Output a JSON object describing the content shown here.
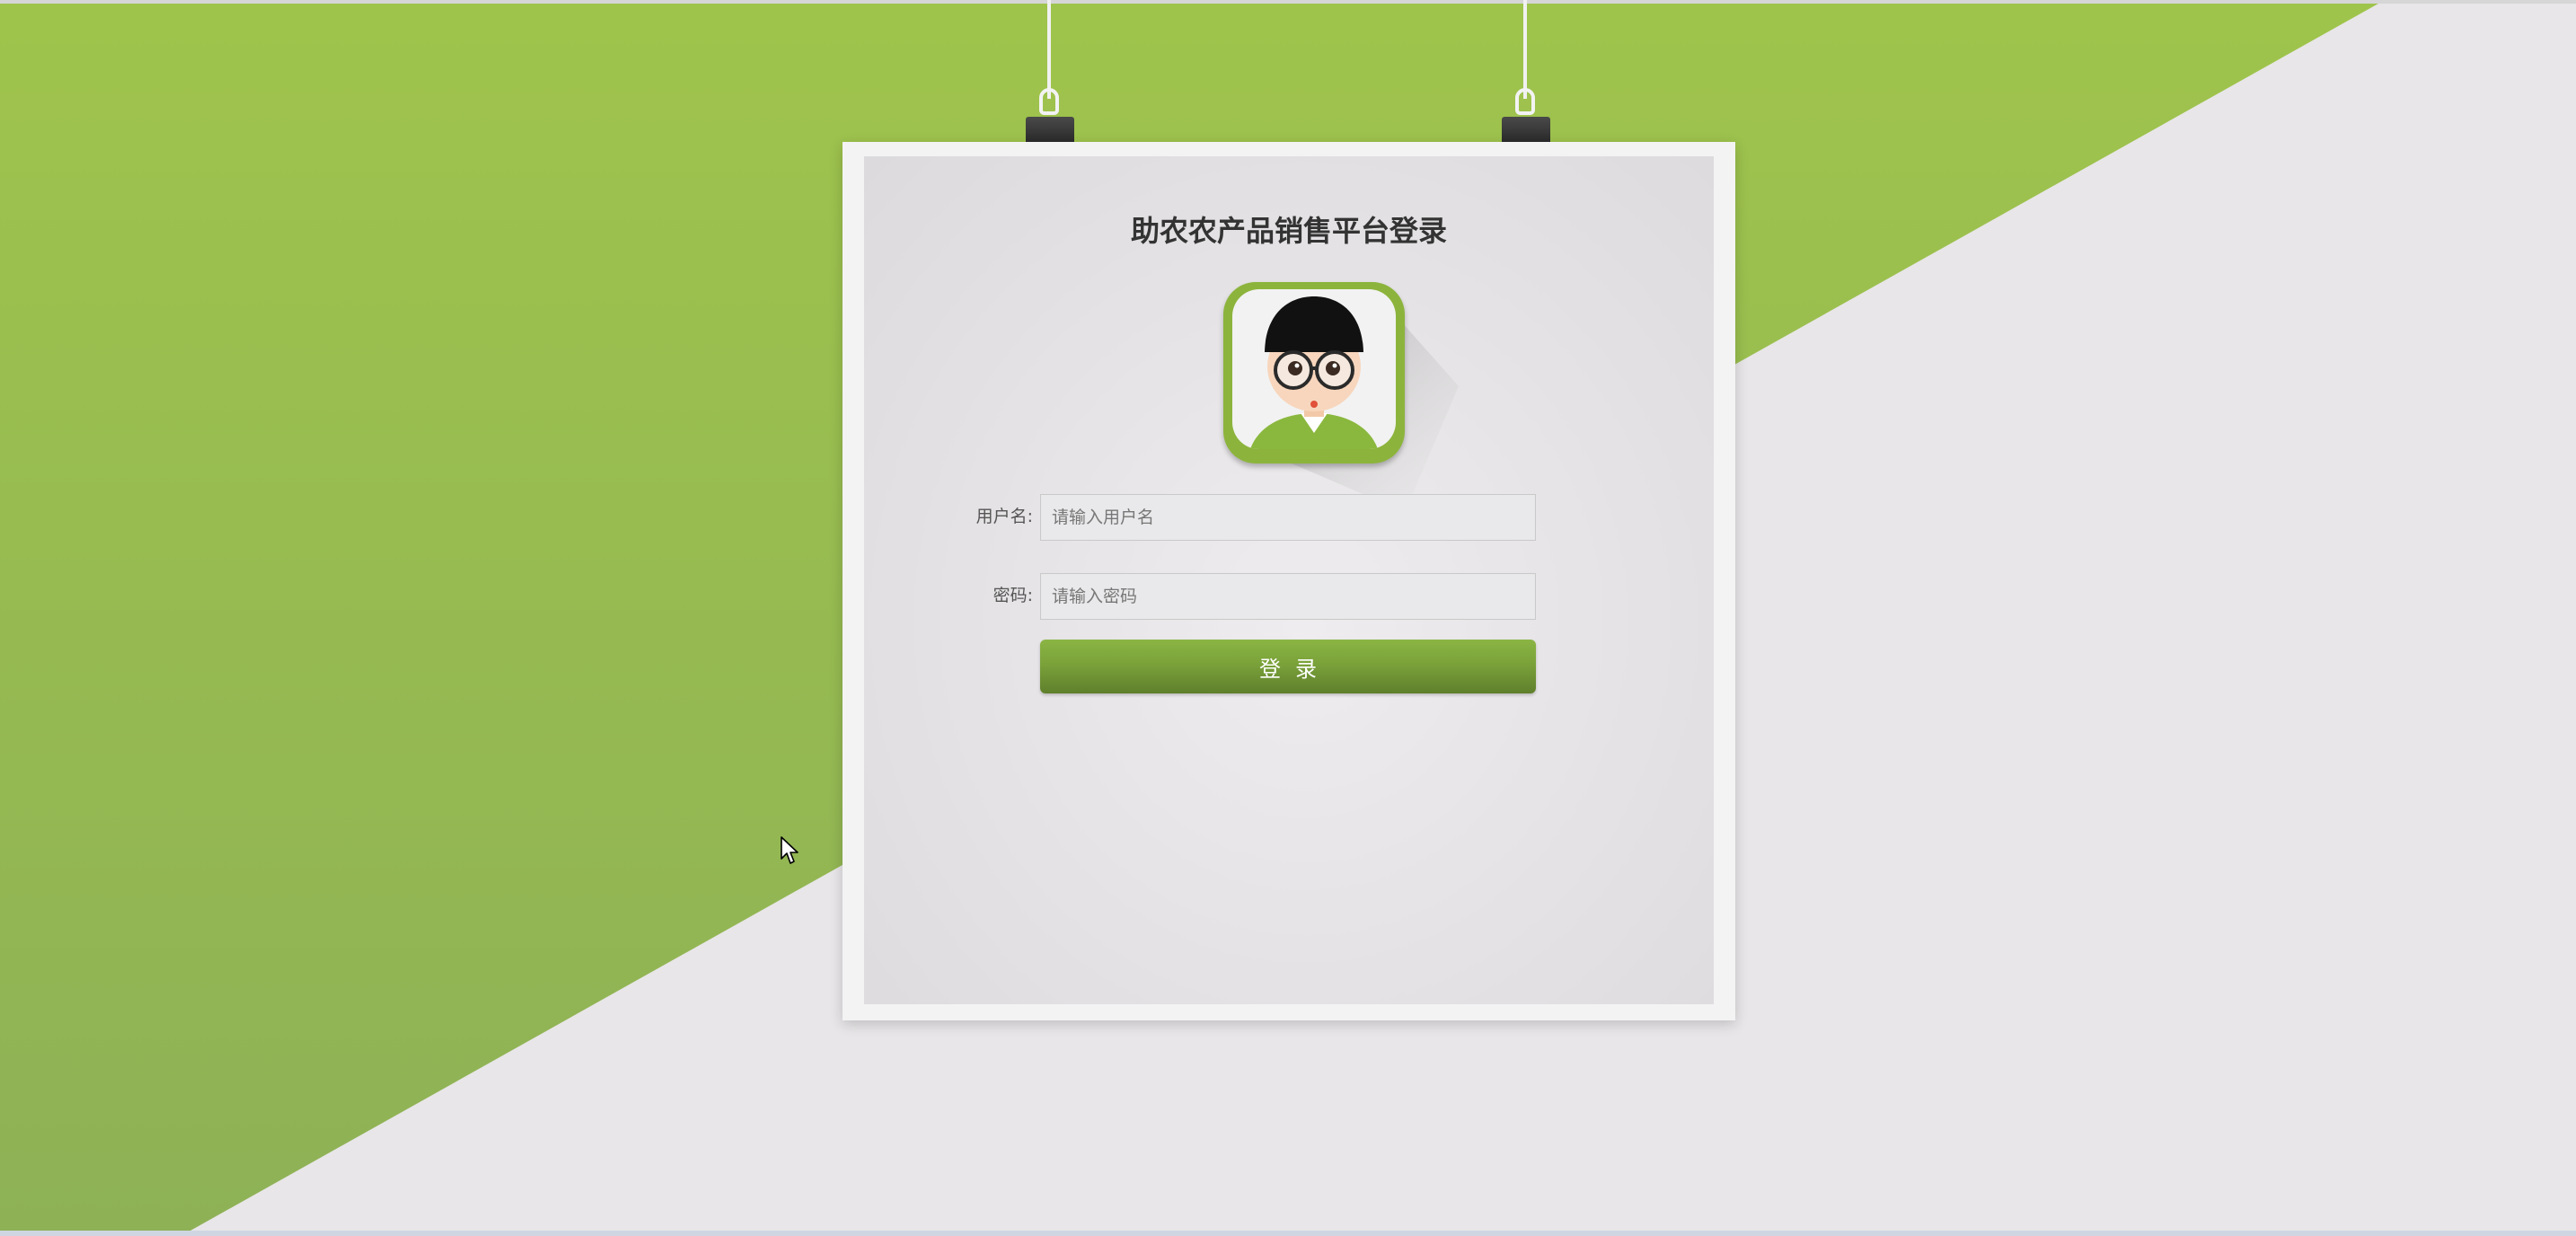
{
  "page": {
    "title": "助农农产品销售平台登录"
  },
  "colors": {
    "brand_green": "#9bc04c",
    "button_green": "#7aa23a",
    "background_light": "#e8e6e8"
  },
  "form": {
    "username": {
      "label": "用户名:",
      "placeholder": "请输入用户名",
      "value": ""
    },
    "password": {
      "label": "密码:",
      "placeholder": "请输入密码",
      "value": ""
    },
    "submit_label": "登录"
  },
  "icons": {
    "avatar": "user-avatar-icon",
    "cursor": "mouse-cursor-icon",
    "clip": "binder-clip-icon"
  }
}
